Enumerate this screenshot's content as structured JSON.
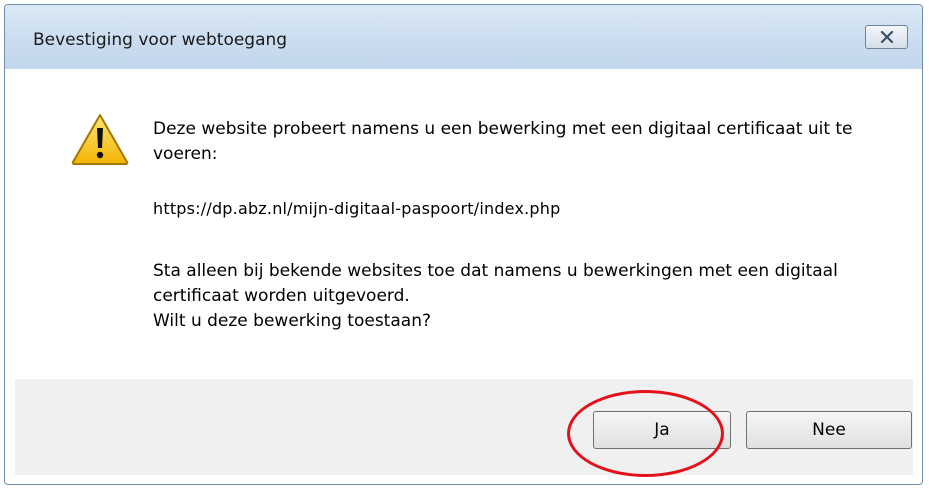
{
  "window": {
    "title": "Bevestiging voor webtoegang",
    "close_icon": "close-x-icon"
  },
  "message": {
    "icon": "warning-icon",
    "paragraph1": "Deze website probeert namens u een bewerking met een digitaal certificaat uit te voeren:",
    "url": "https://dp.abz.nl/mijn-digitaal-paspoort/index.php",
    "paragraph2_line1": "Sta alleen bij bekende websites toe dat namens u bewerkingen met een digitaal certificaat worden uitgevoerd.",
    "paragraph2_line2": "Wilt u deze bewerking toestaan?"
  },
  "buttons": {
    "yes_label": "Ja",
    "no_label": "Nee"
  },
  "annotation": {
    "color": "#e4101b",
    "shape": "ellipse"
  }
}
